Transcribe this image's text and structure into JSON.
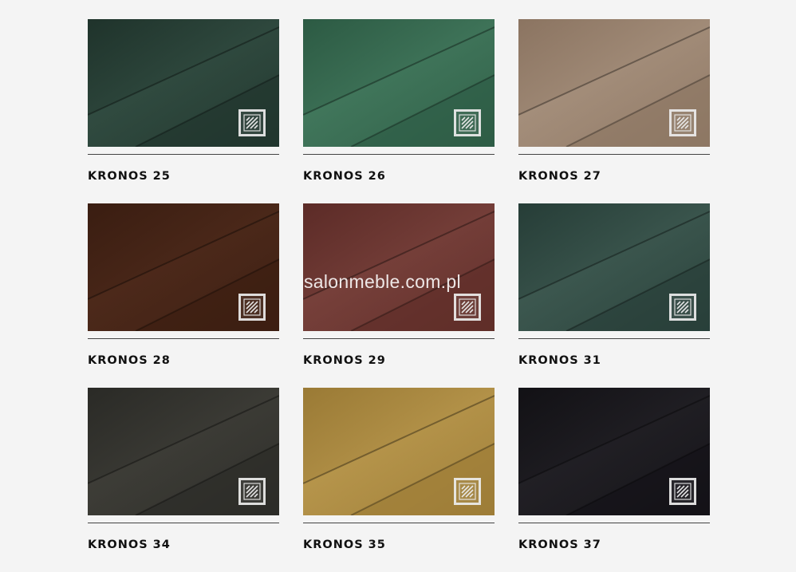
{
  "watermark": "salonmeble.com.pl",
  "badge_icon": "fabric-pattern-icon",
  "swatches": [
    {
      "name": "KRONOS 25",
      "color_light": "#3d5c4f",
      "color_dark": "#1f332b"
    },
    {
      "name": "KRONOS 26",
      "color_light": "#4f8a6c",
      "color_dark": "#2c5a43"
    },
    {
      "name": "KRONOS 27",
      "color_light": "#b5a08c",
      "color_dark": "#8b7461"
    },
    {
      "name": "KRONOS 28",
      "color_light": "#5a3221",
      "color_dark": "#3a1d11"
    },
    {
      "name": "KRONOS 29",
      "color_light": "#8a4f48",
      "color_dark": "#5c2b27"
    },
    {
      "name": "KRONOS 31",
      "color_light": "#4c6a60",
      "color_dark": "#263d37"
    },
    {
      "name": "KRONOS 34",
      "color_light": "#4b4a43",
      "color_dark": "#2a2a26"
    },
    {
      "name": "KRONOS 35",
      "color_light": "#c9a75a",
      "color_dark": "#9a7a35"
    },
    {
      "name": "KRONOS 37",
      "color_light": "#2c2a30",
      "color_dark": "#121115"
    }
  ]
}
